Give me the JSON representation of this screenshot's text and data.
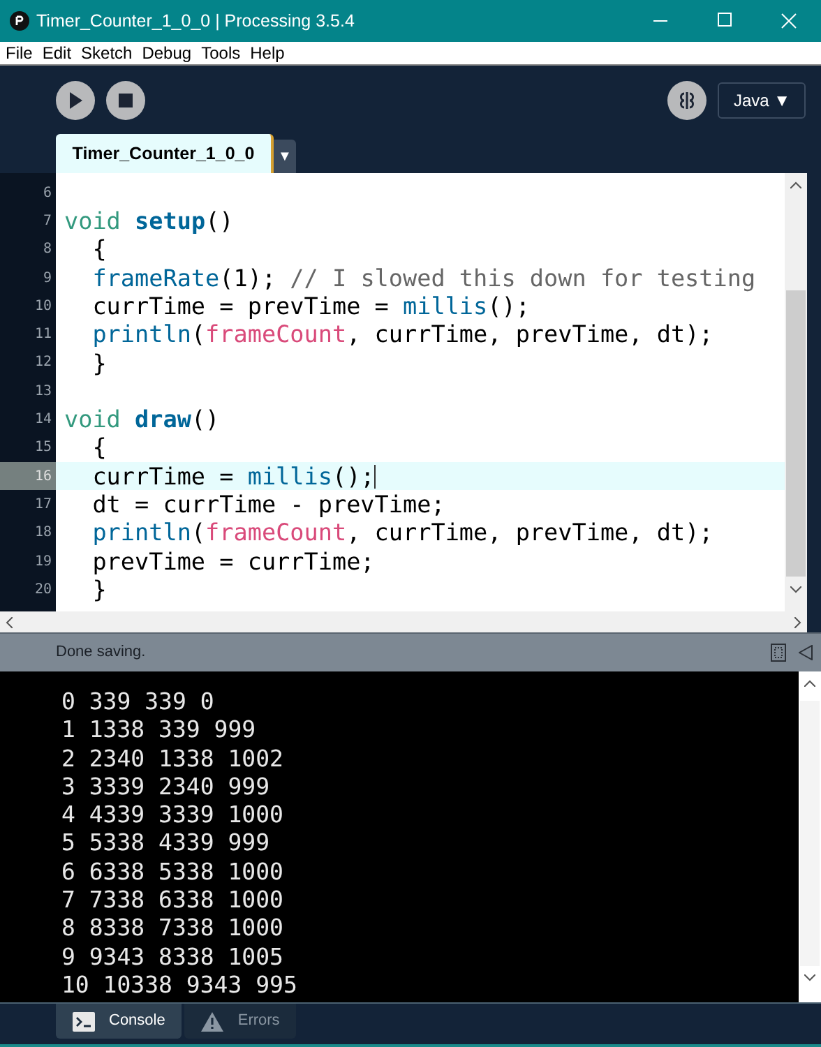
{
  "window": {
    "title": "Timer_Counter_1_0_0 | Processing 3.5.4"
  },
  "menu": [
    "File",
    "Edit",
    "Sketch",
    "Debug",
    "Tools",
    "Help"
  ],
  "toolbar": {
    "mode": "Java ▼"
  },
  "tabs": [
    {
      "label": "Timer_Counter_1_0_0",
      "selected": true
    }
  ],
  "tab_menu": "▼",
  "editor": {
    "lines": [
      {
        "number": "6",
        "current": false
      },
      {
        "number": "7",
        "current": false,
        "tokens": [
          {
            "text": "void ",
            "kind": "keyword"
          },
          {
            "text": "setup",
            "kind": "definition"
          },
          {
            "text": "()",
            "kind": "plain"
          }
        ]
      },
      {
        "number": "8",
        "current": false,
        "tokens": [
          {
            "text": "  {",
            "kind": "plain"
          }
        ]
      },
      {
        "number": "9",
        "current": false,
        "tokens": [
          {
            "text": "  frameRate",
            "kind": "function"
          },
          {
            "text": "(1); ",
            "kind": "plain"
          },
          {
            "text": "// I slowed this down for testing",
            "kind": "comment"
          }
        ]
      },
      {
        "number": "10",
        "current": false,
        "tokens": [
          {
            "text": "  currTime = prevTime = ",
            "kind": "plain"
          },
          {
            "text": "millis",
            "kind": "function"
          },
          {
            "text": "();",
            "kind": "plain"
          }
        ]
      },
      {
        "number": "11",
        "current": false,
        "tokens": [
          {
            "text": "  println",
            "kind": "function"
          },
          {
            "text": "(",
            "kind": "plain"
          },
          {
            "text": "frameCount",
            "kind": "variable"
          },
          {
            "text": ", currTime, prevTime, dt);",
            "kind": "plain"
          }
        ]
      },
      {
        "number": "12",
        "current": false,
        "tokens": [
          {
            "text": "  }",
            "kind": "plain"
          }
        ]
      },
      {
        "number": "13",
        "current": false
      },
      {
        "number": "14",
        "current": false,
        "tokens": [
          {
            "text": "void ",
            "kind": "keyword"
          },
          {
            "text": "draw",
            "kind": "definition"
          },
          {
            "text": "()",
            "kind": "plain"
          }
        ]
      },
      {
        "number": "15",
        "current": false,
        "tokens": [
          {
            "text": "  {",
            "kind": "plain"
          }
        ]
      },
      {
        "number": "16",
        "current": true,
        "tokens": [
          {
            "text": "  currTime = ",
            "kind": "plain"
          },
          {
            "text": "millis",
            "kind": "function"
          },
          {
            "text": "();",
            "kind": "plain"
          }
        ]
      },
      {
        "number": "17",
        "current": false,
        "tokens": [
          {
            "text": "  dt = currTime - prevTime;",
            "kind": "plain"
          }
        ]
      },
      {
        "number": "18",
        "current": false,
        "tokens": [
          {
            "text": "  println",
            "kind": "function"
          },
          {
            "text": "(",
            "kind": "plain"
          },
          {
            "text": "frameCount",
            "kind": "variable"
          },
          {
            "text": ", currTime, prevTime, dt);",
            "kind": "plain"
          }
        ]
      },
      {
        "number": "19",
        "current": false,
        "tokens": [
          {
            "text": "  prevTime = currTime;",
            "kind": "plain"
          }
        ]
      },
      {
        "number": "20",
        "current": false,
        "tokens": [
          {
            "text": "  }",
            "kind": "plain"
          }
        ]
      }
    ]
  },
  "status_bar": {
    "message": "Done saving."
  },
  "console": {
    "lines": [
      "0 339 339 0",
      "1 1338 339 999",
      "2 2340 1338 1002",
      "3 3339 2340 999",
      "4 4339 3339 1000",
      "5 5338 4339 999",
      "6 6338 5338 1000",
      "7 7338 6338 1000",
      "8 8338 7338 1000",
      "9 9343 8338 1005",
      "10 10338 9343 995"
    ]
  },
  "console_tabs": [
    {
      "label": "Console",
      "kind": "console",
      "selected": true
    },
    {
      "label": "Errors",
      "kind": "errors",
      "selected": false
    }
  ]
}
